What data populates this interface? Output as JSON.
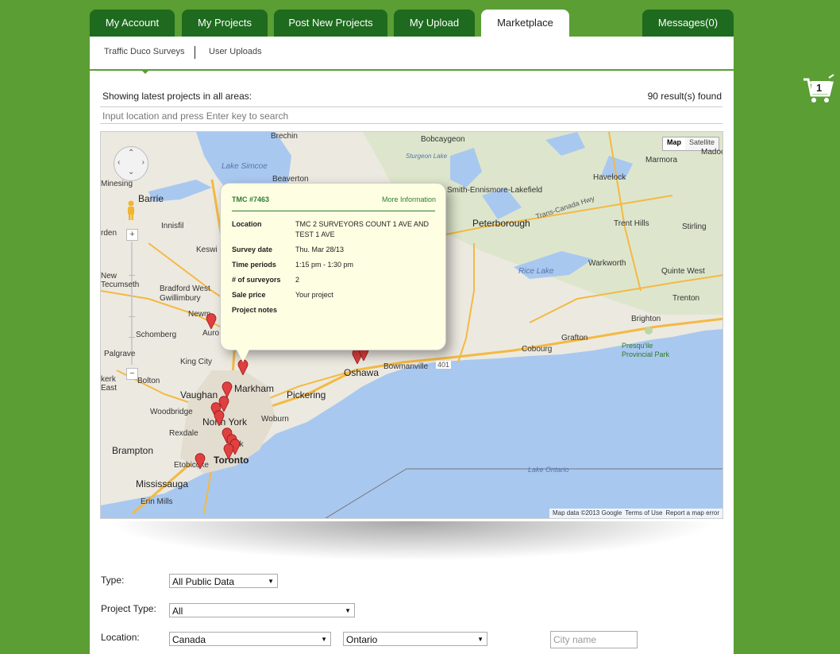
{
  "tabs": [
    {
      "label": "My Account"
    },
    {
      "label": "My Projects"
    },
    {
      "label": "Post New Projects"
    },
    {
      "label": "My Upload"
    },
    {
      "label": "Marketplace"
    },
    {
      "label": "Messages(0)"
    }
  ],
  "subnav": {
    "items": [
      {
        "label": "Traffic Duco Surveys"
      },
      {
        "label": "User Uploads"
      }
    ]
  },
  "header": {
    "showing": "Showing latest projects in all areas:",
    "results": "90 result(s) found"
  },
  "search": {
    "placeholder": "Input location and press Enter key to search"
  },
  "map": {
    "toggle": {
      "map": "Map",
      "satellite": "Satellite"
    },
    "labels": {
      "brechin": "Brechin",
      "bobcaygeon": "Bobcaygeon",
      "lake_simcoe": "Lake Simcoe",
      "beaverton": "Beaverton",
      "barrie": "Barrie",
      "innisfil": "Innisfil",
      "bradford": "Bradford West Gwillimbury",
      "newmarket": "Newm",
      "schomberg": "Schomberg",
      "king_city": "King City",
      "vaughan": "Vaughan",
      "markham": "Markham",
      "woodbridge": "Woodbridge",
      "north_york": "North York",
      "york": "York",
      "toronto": "Toronto",
      "brampton": "Brampton",
      "mississauga": "Mississauga",
      "etobicoke": "Etobicoke",
      "erin_mills": "Erin Mills",
      "pickering": "Pickering",
      "woburn": "Woburn",
      "oshawa": "Oshawa",
      "bowmanville": "Bowmanville",
      "cobourg": "Cobourg",
      "grafton": "Grafton",
      "peterborough": "Peterborough",
      "havelock": "Havelock",
      "marmora": "Marmora",
      "madoc": "Madoc",
      "trent_hills": "Trent Hills",
      "stirling": "Stirling",
      "warkworth": "Warkworth",
      "quinte_west": "Quinte West",
      "trenton": "Trenton",
      "brighton": "Brighton",
      "presquile": "Presqu'ile Provincial Park",
      "rice_lake": "Rice Lake",
      "lake_ontario": "Lake Ontario",
      "smith_ennismore": "Smith-Ennismore-Lakefield",
      "trans_canada": "Trans-Canada Hwy",
      "keswick": "Keswi",
      "palgrave": "Palgrave",
      "bolton": "Bolton",
      "rexdale": "Rexdale",
      "sturgeon": "Sturgeon Lake",
      "minesing": "Minesing",
      "rden": "rden",
      "new_tecumseth": "New Tecumseth",
      "aurora": "Auro",
      "kerk_east": "kerk East",
      "hwy401": "401"
    },
    "attribution": [
      "Map data ©2013 Google",
      "Terms of Use",
      "Report a map error"
    ],
    "zoom": {
      "plus": "+",
      "minus": "−"
    },
    "popup": {
      "title": "TMC #7463",
      "more": "More Information",
      "rows": [
        {
          "label": "Location",
          "value": "TMC 2 SURVEYORS COUNT 1 AVE AND TEST 1 AVE"
        },
        {
          "label": "Survey date",
          "value": "Thu. Mar 28/13"
        },
        {
          "label": "Time periods",
          "value": "1:15 pm - 1:30 pm"
        },
        {
          "label": "# of surveyors",
          "value": "2"
        },
        {
          "label": "Sale price",
          "value": "Your project"
        },
        {
          "label": "Project notes",
          "value": ""
        }
      ]
    }
  },
  "filters": {
    "type_label": "Type:",
    "type_value": "All Public Data",
    "project_type_label": "Project Type:",
    "project_type_value": "All",
    "location_label": "Location:",
    "country_value": "Canada",
    "province_value": "Ontario",
    "city_placeholder": "City name"
  },
  "cart": {
    "count": "1"
  },
  "colors": {
    "brand_green": "#5a9e34",
    "tab_dark": "#1e6a1e",
    "water": "#a9c8f0",
    "pin": "#e04040"
  }
}
